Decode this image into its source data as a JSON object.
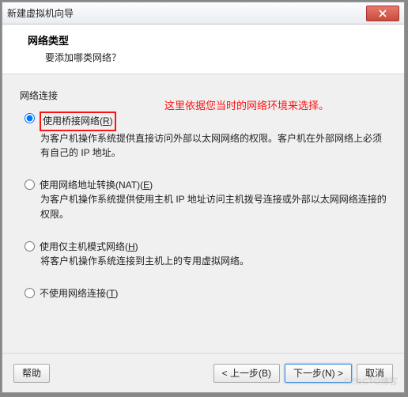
{
  "window": {
    "title": "新建虚拟机向导"
  },
  "header": {
    "title": "网络类型",
    "desc": "要添加哪类网络？"
  },
  "section_label": "网络连接",
  "annotation": "这里依据您当时的网络环境来选择。",
  "options": {
    "bridged": {
      "label": "使用桥接网络(",
      "hotkey": "R",
      "label_suffix": ")",
      "desc": "为客户机操作系统提供直接访问外部以太网网络的权限。客户机在外部网络上必须有自己的 IP 地址。",
      "checked": true
    },
    "nat": {
      "label": "使用网络地址转换(NAT)(",
      "hotkey": "E",
      "label_suffix": ")",
      "desc": "为客户机操作系统提供使用主机 IP 地址访问主机拨号连接或外部以太网网络连接的权限。",
      "checked": false
    },
    "hostonly": {
      "label": "使用仅主机模式网络(",
      "hotkey": "H",
      "label_suffix": ")",
      "desc": "将客户机操作系统连接到主机上的专用虚拟网络。",
      "checked": false
    },
    "none": {
      "label": "不使用网络连接(",
      "hotkey": "T",
      "label_suffix": ")",
      "desc": "",
      "checked": false
    }
  },
  "buttons": {
    "help": "帮助",
    "back": "< 上一步(B)",
    "next": "下一步(N) >",
    "cancel": "取消"
  },
  "watermark": "© 51CTO博客"
}
